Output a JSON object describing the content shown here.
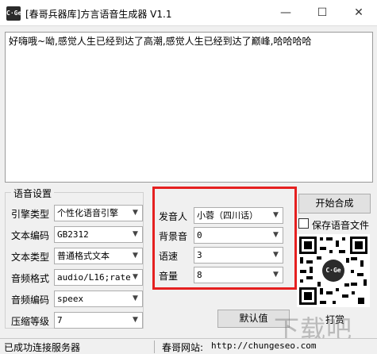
{
  "window": {
    "title": "[春哥兵器库]方言语音生成器 V1.1",
    "app_icon": "C·Ge",
    "min_glyph": "—",
    "max_glyph": "☐",
    "close_glyph": "✕"
  },
  "editor": {
    "text": "好嗨哦~呦,感觉人生已经到达了高潮,感觉人生已经到达了巅峰,哈哈哈哈"
  },
  "settings": {
    "group_title": "语音设置",
    "fields": [
      {
        "label": "引擎类型",
        "value": "个性化语音引擎"
      },
      {
        "label": "文本编码",
        "value": "GB2312"
      },
      {
        "label": "文本类型",
        "value": "普通格式文本"
      },
      {
        "label": "音频格式",
        "value": "audio/L16;rate="
      },
      {
        "label": "音频编码",
        "value": "speex"
      },
      {
        "label": "压缩等级",
        "value": "7"
      }
    ]
  },
  "voice": {
    "fields": [
      {
        "label": "发音人",
        "value": "小蓉（四川话）"
      },
      {
        "label": "背景音",
        "value": "0"
      },
      {
        "label": "语速",
        "value": "3"
      },
      {
        "label": "音量",
        "value": "8"
      }
    ],
    "highlight_color": "#e52020"
  },
  "actions": {
    "start": "开始合成",
    "save_checkbox": "保存语音文件",
    "save_checked": false,
    "default": "默认值",
    "tip": "打赏"
  },
  "qr": {
    "logo": "C·Ge"
  },
  "status": {
    "connection": "已成功连接服务器",
    "site_label": "春哥网站:",
    "site_url": "http://chungeseo.com"
  },
  "watermark": "下载吧",
  "colors": {
    "accent": "#e52020"
  }
}
